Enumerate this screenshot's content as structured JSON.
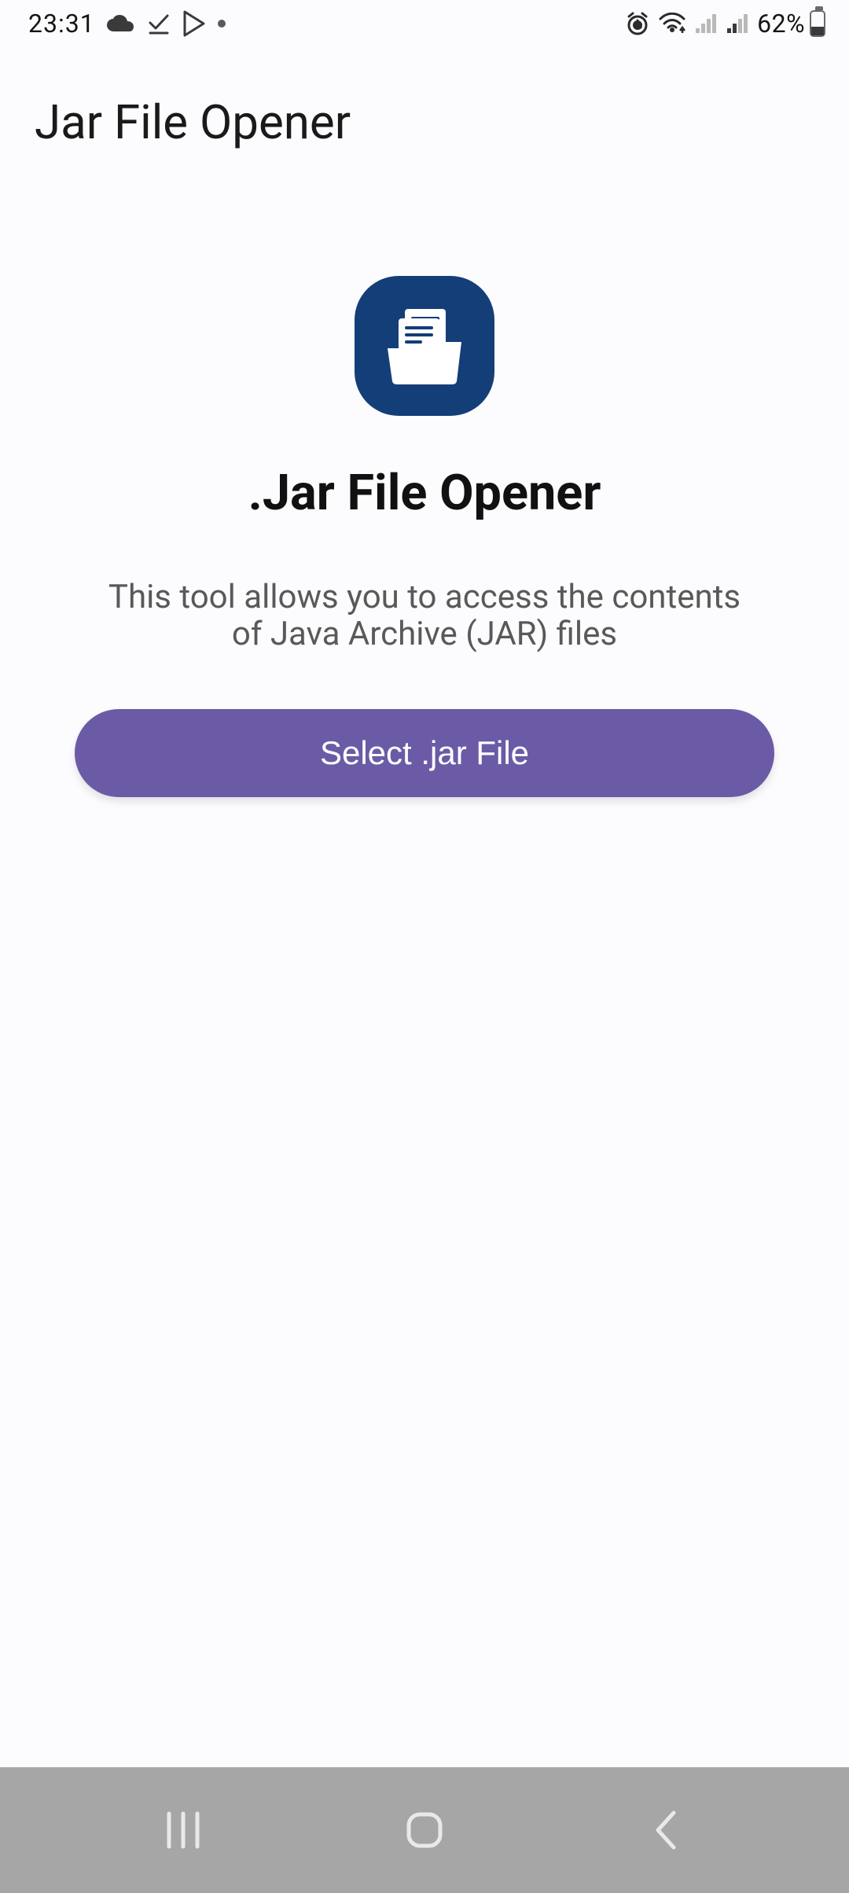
{
  "status": {
    "time": "23:31",
    "battery_text": "62%"
  },
  "header": {
    "app_title": "Jar File Opener"
  },
  "main": {
    "headline": ".Jar File Opener",
    "subhead": "This tool allows you to access the contents of Java Archive (JAR) files",
    "select_button_label": "Select .jar File"
  },
  "colors": {
    "accent_button": "#6b5ba6",
    "app_icon_bg": "#143e78"
  }
}
